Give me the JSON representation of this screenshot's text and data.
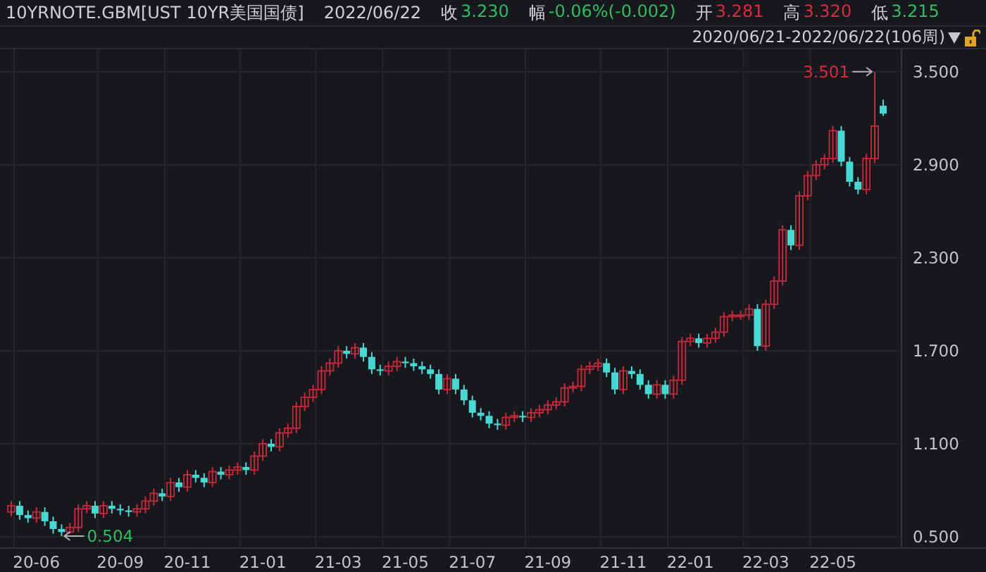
{
  "header": {
    "symbol": "10YRNOTE.GBM[UST 10YR美国国债]",
    "date": "2022/06/22",
    "quotes": [
      {
        "label": "收",
        "value": "3.230",
        "color": "#2dbf5f"
      },
      {
        "label": "幅",
        "value": "-0.06%(-0.002)",
        "color": "#2dbf5f"
      },
      {
        "label": "开",
        "value": "3.281",
        "color": "#e0283c"
      },
      {
        "label": "高",
        "value": "3.320",
        "color": "#e0283c"
      },
      {
        "label": "低",
        "value": "3.215",
        "color": "#2dbf5f"
      }
    ]
  },
  "range": {
    "text": "2020/06/21-2022/06/22(106周)"
  },
  "chart": {
    "chart_data": {
      "type": "candlestick",
      "grid": true,
      "categories": [
        null,
        null,
        null,
        "20-06",
        null,
        null,
        null,
        null,
        null,
        null,
        null,
        null,
        null,
        "20-09",
        null,
        null,
        null,
        null,
        null,
        null,
        null,
        "20-11",
        null,
        null,
        null,
        null,
        null,
        null,
        null,
        null,
        "21-01",
        null,
        null,
        null,
        null,
        null,
        null,
        null,
        null,
        "21-03",
        null,
        null,
        null,
        null,
        null,
        null,
        null,
        "21-05",
        null,
        null,
        null,
        null,
        null,
        null,
        null,
        "21-07",
        null,
        null,
        null,
        null,
        null,
        null,
        null,
        null,
        "21-09",
        null,
        null,
        null,
        null,
        null,
        null,
        null,
        null,
        "21-11",
        null,
        null,
        null,
        null,
        null,
        null,
        null,
        "22-01",
        null,
        null,
        null,
        null,
        null,
        null,
        null,
        null,
        "22-03",
        null,
        null,
        null,
        null,
        null,
        null,
        null,
        "22-05",
        null,
        null,
        null,
        null,
        null,
        null
      ],
      "ohlc": [
        [
          0.66,
          0.73,
          0.63,
          0.7
        ],
        [
          0.7,
          0.73,
          0.61,
          0.64
        ],
        [
          0.64,
          0.67,
          0.59,
          0.62
        ],
        [
          0.62,
          0.69,
          0.59,
          0.66
        ],
        [
          0.66,
          0.69,
          0.57,
          0.6
        ],
        [
          0.6,
          0.63,
          0.52,
          0.55
        ],
        [
          0.55,
          0.58,
          0.504,
          0.53
        ],
        [
          0.53,
          0.59,
          0.52,
          0.56
        ],
        [
          0.56,
          0.71,
          0.53,
          0.68
        ],
        [
          0.68,
          0.73,
          0.65,
          0.7
        ],
        [
          0.7,
          0.73,
          0.62,
          0.65
        ],
        [
          0.65,
          0.73,
          0.62,
          0.7
        ],
        [
          0.7,
          0.73,
          0.65,
          0.68
        ],
        [
          0.68,
          0.71,
          0.64,
          0.67
        ],
        [
          0.67,
          0.7,
          0.63,
          0.66
        ],
        [
          0.66,
          0.71,
          0.63,
          0.68
        ],
        [
          0.68,
          0.76,
          0.65,
          0.73
        ],
        [
          0.73,
          0.81,
          0.7,
          0.78
        ],
        [
          0.78,
          0.81,
          0.73,
          0.76
        ],
        [
          0.76,
          0.88,
          0.73,
          0.85
        ],
        [
          0.85,
          0.88,
          0.79,
          0.82
        ],
        [
          0.82,
          0.93,
          0.79,
          0.9
        ],
        [
          0.9,
          0.93,
          0.85,
          0.88
        ],
        [
          0.88,
          0.91,
          0.82,
          0.85
        ],
        [
          0.85,
          0.95,
          0.82,
          0.92
        ],
        [
          0.92,
          0.95,
          0.87,
          0.9
        ],
        [
          0.9,
          0.96,
          0.87,
          0.93
        ],
        [
          0.93,
          0.98,
          0.9,
          0.95
        ],
        [
          0.95,
          0.98,
          0.9,
          0.93
        ],
        [
          0.93,
          1.05,
          0.9,
          1.02
        ],
        [
          1.02,
          1.13,
          0.99,
          1.1
        ],
        [
          1.1,
          1.13,
          1.05,
          1.08
        ],
        [
          1.08,
          1.2,
          1.05,
          1.17
        ],
        [
          1.17,
          1.23,
          1.14,
          1.2
        ],
        [
          1.2,
          1.37,
          1.17,
          1.34
        ],
        [
          1.34,
          1.43,
          1.31,
          1.4
        ],
        [
          1.4,
          1.48,
          1.37,
          1.45
        ],
        [
          1.45,
          1.6,
          1.42,
          1.57
        ],
        [
          1.57,
          1.65,
          1.54,
          1.62
        ],
        [
          1.62,
          1.73,
          1.59,
          1.7
        ],
        [
          1.7,
          1.73,
          1.65,
          1.68
        ],
        [
          1.68,
          1.75,
          1.65,
          1.72
        ],
        [
          1.72,
          1.75,
          1.63,
          1.66
        ],
        [
          1.66,
          1.69,
          1.55,
          1.58
        ],
        [
          1.58,
          1.61,
          1.54,
          1.57
        ],
        [
          1.57,
          1.63,
          1.54,
          1.6
        ],
        [
          1.6,
          1.66,
          1.57,
          1.63
        ],
        [
          1.63,
          1.66,
          1.59,
          1.62
        ],
        [
          1.62,
          1.65,
          1.57,
          1.6
        ],
        [
          1.6,
          1.63,
          1.55,
          1.58
        ],
        [
          1.58,
          1.61,
          1.52,
          1.55
        ],
        [
          1.55,
          1.58,
          1.42,
          1.45
        ],
        [
          1.45,
          1.55,
          1.42,
          1.52
        ],
        [
          1.52,
          1.55,
          1.42,
          1.45
        ],
        [
          1.45,
          1.48,
          1.35,
          1.38
        ],
        [
          1.38,
          1.41,
          1.27,
          1.3
        ],
        [
          1.3,
          1.33,
          1.25,
          1.28
        ],
        [
          1.28,
          1.31,
          1.2,
          1.23
        ],
        [
          1.23,
          1.26,
          1.19,
          1.22
        ],
        [
          1.22,
          1.3,
          1.19,
          1.27
        ],
        [
          1.27,
          1.31,
          1.24,
          1.28
        ],
        [
          1.28,
          1.31,
          1.24,
          1.27
        ],
        [
          1.27,
          1.33,
          1.24,
          1.3
        ],
        [
          1.3,
          1.35,
          1.27,
          1.32
        ],
        [
          1.32,
          1.38,
          1.29,
          1.35
        ],
        [
          1.35,
          1.4,
          1.32,
          1.37
        ],
        [
          1.37,
          1.49,
          1.34,
          1.46
        ],
        [
          1.46,
          1.5,
          1.43,
          1.47
        ],
        [
          1.47,
          1.61,
          1.44,
          1.58
        ],
        [
          1.58,
          1.63,
          1.55,
          1.6
        ],
        [
          1.6,
          1.65,
          1.57,
          1.62
        ],
        [
          1.62,
          1.65,
          1.53,
          1.56
        ],
        [
          1.56,
          1.59,
          1.42,
          1.45
        ],
        [
          1.45,
          1.6,
          1.42,
          1.57
        ],
        [
          1.57,
          1.6,
          1.52,
          1.55
        ],
        [
          1.55,
          1.58,
          1.45,
          1.48
        ],
        [
          1.48,
          1.51,
          1.39,
          1.42
        ],
        [
          1.42,
          1.51,
          1.39,
          1.48
        ],
        [
          1.48,
          1.51,
          1.39,
          1.42
        ],
        [
          1.42,
          1.54,
          1.39,
          1.51
        ],
        [
          1.51,
          1.79,
          1.48,
          1.76
        ],
        [
          1.76,
          1.81,
          1.73,
          1.78
        ],
        [
          1.78,
          1.81,
          1.72,
          1.75
        ],
        [
          1.75,
          1.81,
          1.72,
          1.78
        ],
        [
          1.78,
          1.85,
          1.75,
          1.82
        ],
        [
          1.82,
          1.95,
          1.79,
          1.92
        ],
        [
          1.92,
          1.96,
          1.89,
          1.93
        ],
        [
          1.93,
          1.96,
          1.9,
          1.93
        ],
        [
          1.93,
          2.0,
          1.9,
          1.97
        ],
        [
          1.97,
          2.0,
          1.7,
          1.73
        ],
        [
          1.73,
          2.03,
          1.7,
          2.0
        ],
        [
          2.0,
          2.18,
          1.97,
          2.15
        ],
        [
          2.15,
          2.51,
          2.12,
          2.48
        ],
        [
          2.48,
          2.51,
          2.35,
          2.38
        ],
        [
          2.38,
          2.73,
          2.35,
          2.7
        ],
        [
          2.7,
          2.86,
          2.67,
          2.83
        ],
        [
          2.83,
          2.93,
          2.8,
          2.9
        ],
        [
          2.9,
          2.97,
          2.87,
          2.94
        ],
        [
          2.94,
          3.15,
          2.91,
          3.12
        ],
        [
          3.12,
          3.15,
          2.89,
          2.92
        ],
        [
          2.92,
          2.95,
          2.76,
          2.79
        ],
        [
          2.79,
          2.82,
          2.71,
          2.74
        ],
        [
          2.74,
          2.97,
          2.71,
          2.94
        ],
        [
          2.94,
          3.501,
          2.91,
          3.15
        ],
        [
          3.281,
          3.32,
          3.215,
          3.23
        ]
      ],
      "ylim": [
        0.427,
        3.645
      ],
      "yticks": [
        {
          "value": 3.5,
          "label": "3.500"
        },
        {
          "value": 2.9,
          "label": "2.900"
        },
        {
          "value": 2.3,
          "label": "2.300"
        },
        {
          "value": 1.7,
          "label": "1.700"
        },
        {
          "value": 1.1,
          "label": "1.100"
        },
        {
          "value": 0.5,
          "label": "0.500"
        }
      ]
    },
    "high_marker": {
      "text": "3.501",
      "color": "#e0283c"
    },
    "low_marker": {
      "text": "0.504",
      "color": "#2dbf5f"
    }
  }
}
